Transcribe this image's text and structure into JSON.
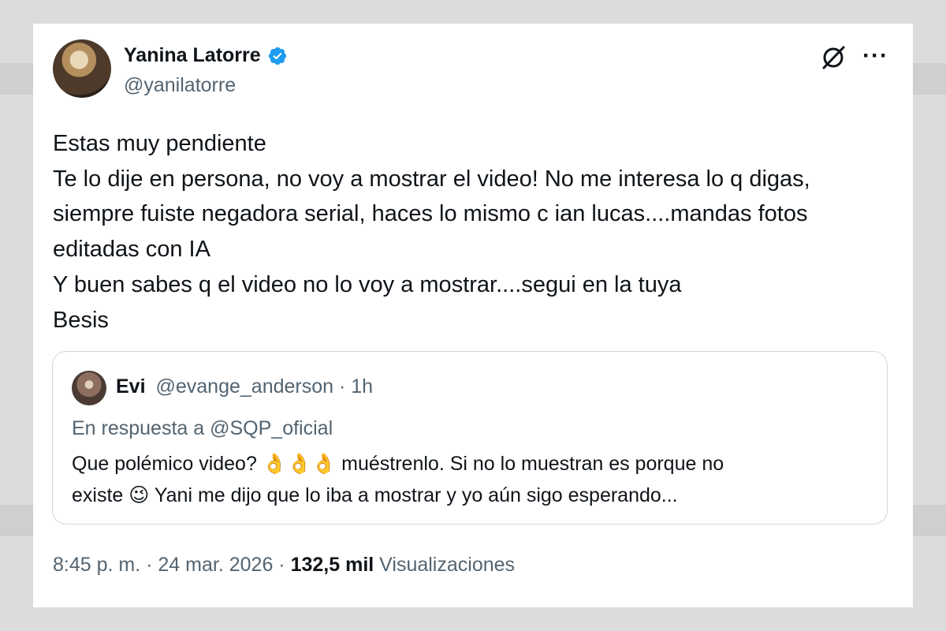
{
  "author": {
    "name": "Yanina Latorre",
    "handle": "@yanilatorre"
  },
  "tweet": {
    "lines": [
      "Estas muy pendiente",
      "Te lo dije en persona, no voy a mostrar el video! No me interesa lo q digas,",
      "siempre fuiste negadora serial, haces lo mismo c ian lucas....mandas fotos",
      "editadas con IA",
      "Y buen sabes q el video no lo voy a mostrar....segui en la tuya",
      "Besis"
    ]
  },
  "quoted": {
    "name": "Evi",
    "handle": "@evange_anderson",
    "separator": "·",
    "time": "1h",
    "reply_prefix": "En respuesta a",
    "reply_to": "@SQP_oficial",
    "line1_before": "Que polémico video? ",
    "line1_emoji": "👌👌👌",
    "line1_after": " muéstrenlo. Si no lo muestran es porque no",
    "line2_before": "existe ",
    "line2_emoji": "😉",
    "line2_after": " Yani me dijo que lo iba a mostrar y yo aún sigo esperando..."
  },
  "meta": {
    "time": "8:45 p. m.",
    "date": "24 mar. 2026",
    "separator": "·",
    "views_count": "132,5 mil",
    "views_label": "Visualizaciones"
  },
  "colors": {
    "verified": "#1d9bf0",
    "text_primary": "#0f1419",
    "text_secondary": "#536471",
    "border": "#cfd9de"
  },
  "icons": {
    "verified": "verified-badge-icon",
    "grok": "grok-icon",
    "more": "more-options-icon"
  }
}
